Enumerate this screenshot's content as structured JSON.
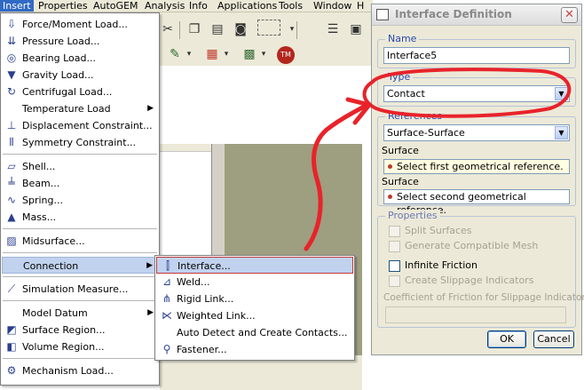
{
  "menubar": {
    "items": [
      "Insert",
      "Properties",
      "AutoGEM",
      "Analysis",
      "Info",
      "Applications",
      "Tools",
      "Window",
      "H"
    ]
  },
  "insert_menu": {
    "items": [
      {
        "label": "Force/Moment Load...",
        "icon": "force-icon"
      },
      {
        "label": "Pressure Load...",
        "icon": "pressure-icon"
      },
      {
        "label": "Bearing Load...",
        "icon": "bearing-icon"
      },
      {
        "label": "Gravity Load...",
        "icon": "gravity-icon"
      },
      {
        "label": "Centrifugal Load...",
        "icon": "centrifugal-icon"
      },
      {
        "label": "Temperature Load",
        "icon": "",
        "submenu": true
      },
      {
        "label": "Displacement Constraint...",
        "icon": "displacement-icon"
      },
      {
        "label": "Symmetry Constraint...",
        "icon": "symmetry-icon"
      },
      {
        "label": "Shell...",
        "icon": "shell-icon"
      },
      {
        "label": "Beam...",
        "icon": "beam-icon"
      },
      {
        "label": "Spring...",
        "icon": "spring-icon"
      },
      {
        "label": "Mass...",
        "icon": "mass-icon"
      },
      {
        "label": "Midsurface...",
        "icon": "midsurface-icon"
      },
      {
        "label": "Connection",
        "icon": "",
        "submenu": true
      },
      {
        "label": "Simulation Measure...",
        "icon": "measure-icon"
      },
      {
        "label": "Model Datum",
        "icon": "",
        "submenu": true
      },
      {
        "label": "Surface Region...",
        "icon": "surface-region-icon"
      },
      {
        "label": "Volume Region...",
        "icon": "volume-region-icon"
      },
      {
        "label": "Mechanism Load...",
        "icon": "mechanism-icon"
      }
    ]
  },
  "connection_menu": {
    "items": [
      {
        "label": "Interface...",
        "icon": "interface-icon"
      },
      {
        "label": "Weld...",
        "icon": "weld-icon"
      },
      {
        "label": "Rigid Link...",
        "icon": "rigid-link-icon"
      },
      {
        "label": "Weighted Link...",
        "icon": "weighted-link-icon"
      },
      {
        "label": "Auto Detect and Create Contacts...",
        "icon": ""
      },
      {
        "label": "Fastener...",
        "icon": "fastener-icon"
      }
    ]
  },
  "dialog": {
    "title": "Interface Definition",
    "name_label": "Name",
    "name_value": "Interface5",
    "type_label": "Type",
    "type_value": "Contact",
    "references_label": "References",
    "references_value": "Surface-Surface",
    "surface1_label": "Surface",
    "surface1_placeholder": "Select first geometrical reference.",
    "surface2_label": "Surface",
    "surface2_placeholder": "Select second geometrical reference.",
    "properties_label": "Properties",
    "split_surfaces": "Split Surfaces",
    "generate_mesh": "Generate Compatible Mesh",
    "infinite_friction": "Infinite Friction",
    "create_slippage": "Create Slippage Indicators",
    "coefficient_label": "Coefficient of Friction for Slippage Indicators",
    "ok_label": "OK",
    "cancel_label": "Cancel"
  },
  "colors": {
    "annotation": "#e8232a",
    "highlight": "#c1d2ee",
    "group_label": "#2648b0"
  }
}
